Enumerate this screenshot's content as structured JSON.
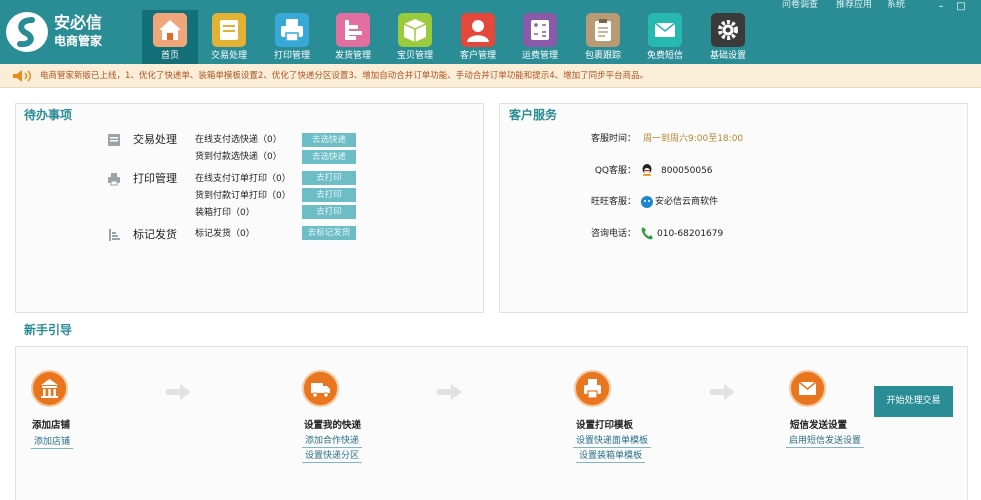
{
  "brand": {
    "name": "安必信",
    "subtitle": "电商管家"
  },
  "toplinks": [
    "问卷调查",
    "推荐应用",
    "系统"
  ],
  "window_controls": [
    "–",
    "□"
  ],
  "nav": [
    {
      "label": "首页",
      "icon": "home-icon",
      "active": true
    },
    {
      "label": "交易处理",
      "icon": "trade-icon"
    },
    {
      "label": "打印管理",
      "icon": "printer-icon"
    },
    {
      "label": "发货管理",
      "icon": "shipping-icon"
    },
    {
      "label": "宝贝管理",
      "icon": "box-icon"
    },
    {
      "label": "客户管理",
      "icon": "customer-icon"
    },
    {
      "label": "运费管理",
      "icon": "calculator-icon"
    },
    {
      "label": "包裹跟踪",
      "icon": "clipboard-icon"
    },
    {
      "label": "免费短信",
      "icon": "mail-icon"
    },
    {
      "label": "基础设置",
      "icon": "gear-icon"
    }
  ],
  "notice": {
    "text": "电商管家新版已上线，1、优化了快递单、装箱单模板设置2、优化了快递分区设置3、增加自动合并订单功能、手动合并订单功能和提示4、增加了同步平台商品。"
  },
  "todo": {
    "title": "待办事项",
    "categories": [
      {
        "label": "交易处理",
        "icon": "trade-small-icon",
        "items": [
          {
            "label": "在线支付选快递（0）",
            "button": "去选快递"
          },
          {
            "label": "货到付款选快递（0）",
            "button": "去选快递"
          }
        ]
      },
      {
        "label": "打印管理",
        "icon": "printer-small-icon",
        "items": [
          {
            "label": "在线支付订单打印（0）",
            "button": "去打印"
          },
          {
            "label": "货到付款订单打印（0）",
            "button": "去打印"
          },
          {
            "label": "装箱打印（0）",
            "button": "去打印"
          }
        ]
      },
      {
        "label": "标记发货",
        "icon": "bars-small-icon",
        "items": [
          {
            "label": "标记发货（0）",
            "button": "去标记发货"
          }
        ]
      }
    ]
  },
  "service": {
    "title": "客户服务",
    "rows": [
      {
        "label": "客服时间：",
        "value": "周一到周六9:00至18:00",
        "icon": "",
        "value_color": "#b5862d"
      },
      {
        "label": "QQ客服：",
        "value": "800050056",
        "icon": "qq-icon",
        "value_color": "#222222"
      },
      {
        "label": "旺旺客服：",
        "value": "安必信云商软件",
        "icon": "wangwang-icon",
        "value_color": "#222222"
      },
      {
        "label": "咨询电话：",
        "value": "010-68201679",
        "icon": "phone-icon",
        "value_color": "#222222"
      }
    ]
  },
  "guide": {
    "title": "新手引导",
    "steps": [
      {
        "title": "添加店铺",
        "icon": "store-icon",
        "links": [
          "添加店铺"
        ]
      },
      {
        "title": "设置我的快递",
        "icon": "truck-icon",
        "links": [
          "添加合作快递",
          "设置快递分区"
        ]
      },
      {
        "title": "设置打印模板",
        "icon": "print-template-icon",
        "links": [
          "设置快递面单模板",
          "设置装箱单模板"
        ]
      },
      {
        "title": "短信发送设置",
        "icon": "envelope-icon",
        "links": [
          "启用短信发送设置"
        ]
      }
    ],
    "start_button": "开始处理交易"
  },
  "colors": {
    "header": "#2a8d96",
    "active_tab": "#136f78",
    "notice_bg": "#fbeed9",
    "notice_text": "#b1521f",
    "task_button": "#6cbdc6",
    "step_icon": "#e9761f"
  }
}
